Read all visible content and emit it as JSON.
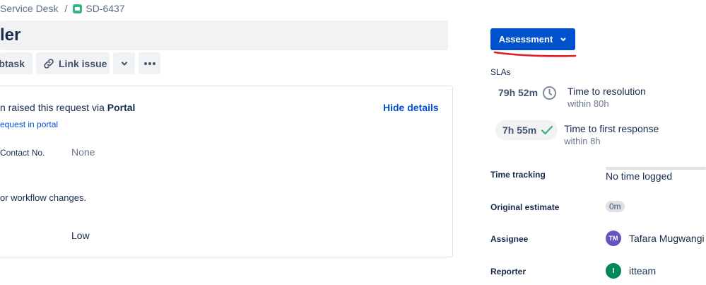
{
  "breadcrumb": {
    "project": "Service Desk",
    "separator": "/",
    "issue_key": "SD-6437"
  },
  "issue": {
    "summary_fragment": "ler"
  },
  "toolbar": {
    "subtask_label": "btask",
    "link_issue_label": "Link issue",
    "icons": [
      "link-icon",
      "chevron-down-icon",
      "more-icon"
    ]
  },
  "request": {
    "raised_prefix": "n raised this request via ",
    "raised_channel": "Portal",
    "hide_details": "Hide details",
    "portal_link": "equest in portal",
    "fields": [
      {
        "label": "Contact No.",
        "value": "None"
      },
      {
        "label": "",
        "value": "Low"
      }
    ],
    "description_fragment": "or workflow changes."
  },
  "status": {
    "label": "Assessment",
    "annotation_color": "#e01b24"
  },
  "slas": {
    "title": "SLAs",
    "items": [
      {
        "time": "79h 52m",
        "icon": "clock-icon",
        "name": "Time to resolution",
        "target": "within 80h"
      },
      {
        "time": "7h 55m",
        "icon": "check-icon",
        "name": "Time to first response",
        "target": "within 8h"
      }
    ]
  },
  "properties": {
    "time_tracking": {
      "label": "Time tracking",
      "value": "No time logged"
    },
    "original_estimate": {
      "label": "Original estimate",
      "value": "0m"
    },
    "assignee": {
      "label": "Assignee",
      "initials": "TM",
      "name": "Tafara Mugwangi"
    },
    "reporter": {
      "label": "Reporter",
      "initials": "I",
      "name": "itteam"
    }
  },
  "colors": {
    "primary": "#0052cc",
    "success": "#36b37e",
    "assignee_avatar": "#6554c0",
    "reporter_avatar": "#00875a"
  }
}
